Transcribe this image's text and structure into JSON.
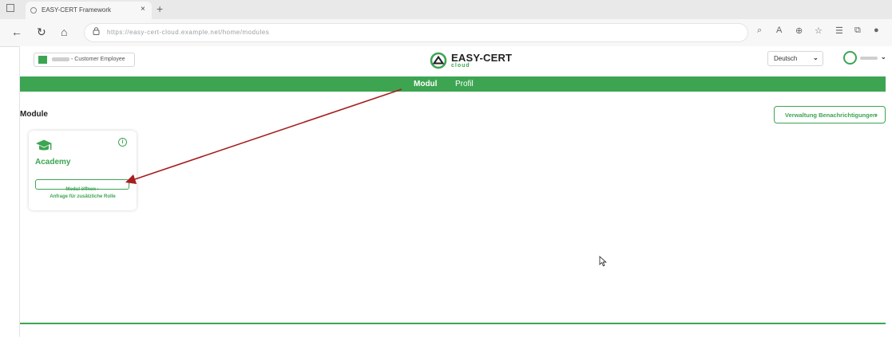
{
  "browser": {
    "tab_title": "EASY-CERT Framework",
    "tab_close": "×",
    "new_tab": "+",
    "address_url": "https://easy-cert-cloud.example.net/home/modules",
    "back_glyph": "←",
    "reload_glyph": "↻",
    "home_glyph": "⌂",
    "lock_glyph": "🔒"
  },
  "header": {
    "account_role": "- Customer Employee",
    "logo_word": "EASY-CERT",
    "logo_sub": "cloud",
    "language": "Deutsch",
    "language_chevron": "⌄",
    "user_chevron": "⌄"
  },
  "nav": {
    "tabs": [
      {
        "label": "Modul"
      },
      {
        "label": "Profil"
      }
    ]
  },
  "main": {
    "title": "Module",
    "notifications_button": "Verwaltung Benachrichtigungen",
    "notifications_chevron": "›",
    "cards": [
      {
        "name": "Academy",
        "info": "i",
        "open_label": "Modul öffnen  ›",
        "request_label": "Anfrage für zusätzliche Rolle"
      }
    ]
  },
  "colors": {
    "brand_green": "#3da552",
    "annotation_arrow": "#a61e1e"
  },
  "icons": {
    "logo": "easy-cert-logo-icon",
    "module_card": "graduation-cap-icon",
    "info": "info-icon",
    "cursor": "mouse-pointer-icon"
  }
}
